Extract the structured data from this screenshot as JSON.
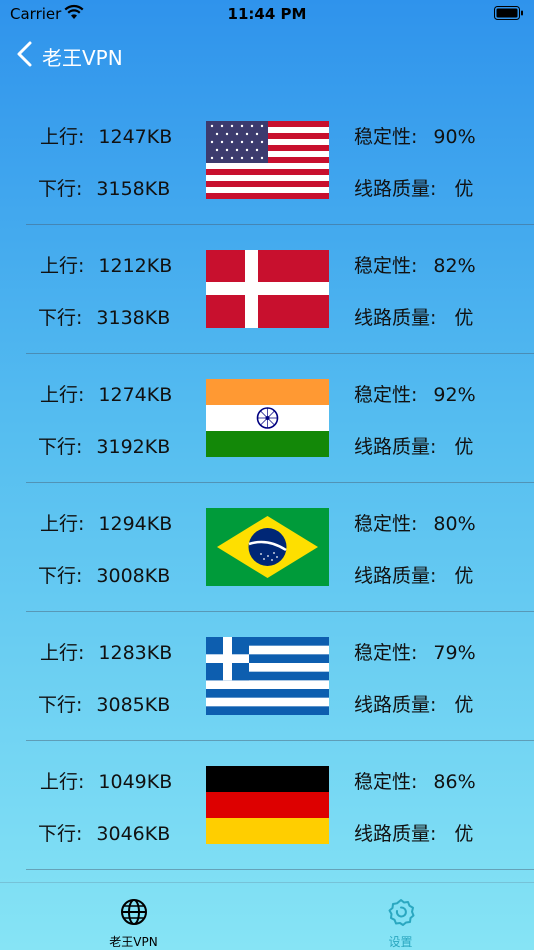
{
  "status_bar": {
    "carrier": "Carrier",
    "time": "11:44 PM"
  },
  "nav": {
    "title": "老王VPN"
  },
  "labels": {
    "up": "上行:",
    "down": "下行:",
    "stability": "稳定性:",
    "quality": "线路质量:"
  },
  "servers": [
    {
      "flag": "us-flag",
      "up": "1247KB",
      "down": "3158KB",
      "stability": "90%",
      "quality": "优"
    },
    {
      "flag": "dk-flag",
      "up": "1212KB",
      "down": "3138KB",
      "stability": "82%",
      "quality": "优"
    },
    {
      "flag": "in-flag",
      "up": "1274KB",
      "down": "3192KB",
      "stability": "92%",
      "quality": "优"
    },
    {
      "flag": "br-flag",
      "up": "1294KB",
      "down": "3008KB",
      "stability": "80%",
      "quality": "优"
    },
    {
      "flag": "gr-flag",
      "up": "1283KB",
      "down": "3085KB",
      "stability": "79%",
      "quality": "优"
    },
    {
      "flag": "de-flag",
      "up": "1049KB",
      "down": "3046KB",
      "stability": "86%",
      "quality": "优"
    }
  ],
  "tabs": [
    {
      "label": "老王VPN",
      "icon": "globe-icon",
      "active": true
    },
    {
      "label": "设置",
      "icon": "gear-icon",
      "active": false
    }
  ],
  "colors": {
    "active_tab": "#000000",
    "inactive_tab": "#2aa7c0"
  }
}
